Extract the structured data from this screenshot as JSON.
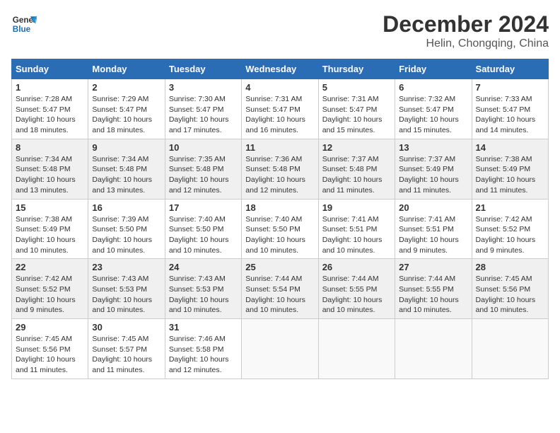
{
  "header": {
    "logo_line1": "General",
    "logo_line2": "Blue",
    "title": "December 2024",
    "subtitle": "Helin, Chongqing, China"
  },
  "calendar": {
    "weekdays": [
      "Sunday",
      "Monday",
      "Tuesday",
      "Wednesday",
      "Thursday",
      "Friday",
      "Saturday"
    ],
    "weeks": [
      [
        {
          "day": "",
          "info": ""
        },
        {
          "day": "",
          "info": ""
        },
        {
          "day": "",
          "info": ""
        },
        {
          "day": "",
          "info": ""
        },
        {
          "day": "5",
          "info": "Sunrise: 7:31 AM\nSunset: 5:47 PM\nDaylight: 10 hours\nand 15 minutes."
        },
        {
          "day": "6",
          "info": "Sunrise: 7:32 AM\nSunset: 5:47 PM\nDaylight: 10 hours\nand 15 minutes."
        },
        {
          "day": "7",
          "info": "Sunrise: 7:33 AM\nSunset: 5:47 PM\nDaylight: 10 hours\nand 14 minutes."
        }
      ],
      [
        {
          "day": "1",
          "info": "Sunrise: 7:28 AM\nSunset: 5:47 PM\nDaylight: 10 hours\nand 18 minutes."
        },
        {
          "day": "2",
          "info": "Sunrise: 7:29 AM\nSunset: 5:47 PM\nDaylight: 10 hours\nand 18 minutes."
        },
        {
          "day": "3",
          "info": "Sunrise: 7:30 AM\nSunset: 5:47 PM\nDaylight: 10 hours\nand 17 minutes."
        },
        {
          "day": "4",
          "info": "Sunrise: 7:31 AM\nSunset: 5:47 PM\nDaylight: 10 hours\nand 16 minutes."
        },
        {
          "day": "5",
          "info": "Sunrise: 7:31 AM\nSunset: 5:47 PM\nDaylight: 10 hours\nand 15 minutes."
        },
        {
          "day": "6",
          "info": "Sunrise: 7:32 AM\nSunset: 5:47 PM\nDaylight: 10 hours\nand 15 minutes."
        },
        {
          "day": "7",
          "info": "Sunrise: 7:33 AM\nSunset: 5:47 PM\nDaylight: 10 hours\nand 14 minutes."
        }
      ],
      [
        {
          "day": "8",
          "info": "Sunrise: 7:34 AM\nSunset: 5:48 PM\nDaylight: 10 hours\nand 13 minutes."
        },
        {
          "day": "9",
          "info": "Sunrise: 7:34 AM\nSunset: 5:48 PM\nDaylight: 10 hours\nand 13 minutes."
        },
        {
          "day": "10",
          "info": "Sunrise: 7:35 AM\nSunset: 5:48 PM\nDaylight: 10 hours\nand 12 minutes."
        },
        {
          "day": "11",
          "info": "Sunrise: 7:36 AM\nSunset: 5:48 PM\nDaylight: 10 hours\nand 12 minutes."
        },
        {
          "day": "12",
          "info": "Sunrise: 7:37 AM\nSunset: 5:48 PM\nDaylight: 10 hours\nand 11 minutes."
        },
        {
          "day": "13",
          "info": "Sunrise: 7:37 AM\nSunset: 5:49 PM\nDaylight: 10 hours\nand 11 minutes."
        },
        {
          "day": "14",
          "info": "Sunrise: 7:38 AM\nSunset: 5:49 PM\nDaylight: 10 hours\nand 11 minutes."
        }
      ],
      [
        {
          "day": "15",
          "info": "Sunrise: 7:38 AM\nSunset: 5:49 PM\nDaylight: 10 hours\nand 10 minutes."
        },
        {
          "day": "16",
          "info": "Sunrise: 7:39 AM\nSunset: 5:50 PM\nDaylight: 10 hours\nand 10 minutes."
        },
        {
          "day": "17",
          "info": "Sunrise: 7:40 AM\nSunset: 5:50 PM\nDaylight: 10 hours\nand 10 minutes."
        },
        {
          "day": "18",
          "info": "Sunrise: 7:40 AM\nSunset: 5:50 PM\nDaylight: 10 hours\nand 10 minutes."
        },
        {
          "day": "19",
          "info": "Sunrise: 7:41 AM\nSunset: 5:51 PM\nDaylight: 10 hours\nand 10 minutes."
        },
        {
          "day": "20",
          "info": "Sunrise: 7:41 AM\nSunset: 5:51 PM\nDaylight: 10 hours\nand 9 minutes."
        },
        {
          "day": "21",
          "info": "Sunrise: 7:42 AM\nSunset: 5:52 PM\nDaylight: 10 hours\nand 9 minutes."
        }
      ],
      [
        {
          "day": "22",
          "info": "Sunrise: 7:42 AM\nSunset: 5:52 PM\nDaylight: 10 hours\nand 9 minutes."
        },
        {
          "day": "23",
          "info": "Sunrise: 7:43 AM\nSunset: 5:53 PM\nDaylight: 10 hours\nand 10 minutes."
        },
        {
          "day": "24",
          "info": "Sunrise: 7:43 AM\nSunset: 5:53 PM\nDaylight: 10 hours\nand 10 minutes."
        },
        {
          "day": "25",
          "info": "Sunrise: 7:44 AM\nSunset: 5:54 PM\nDaylight: 10 hours\nand 10 minutes."
        },
        {
          "day": "26",
          "info": "Sunrise: 7:44 AM\nSunset: 5:55 PM\nDaylight: 10 hours\nand 10 minutes."
        },
        {
          "day": "27",
          "info": "Sunrise: 7:44 AM\nSunset: 5:55 PM\nDaylight: 10 hours\nand 10 minutes."
        },
        {
          "day": "28",
          "info": "Sunrise: 7:45 AM\nSunset: 5:56 PM\nDaylight: 10 hours\nand 10 minutes."
        }
      ],
      [
        {
          "day": "29",
          "info": "Sunrise: 7:45 AM\nSunset: 5:56 PM\nDaylight: 10 hours\nand 11 minutes."
        },
        {
          "day": "30",
          "info": "Sunrise: 7:45 AM\nSunset: 5:57 PM\nDaylight: 10 hours\nand 11 minutes."
        },
        {
          "day": "31",
          "info": "Sunrise: 7:46 AM\nSunset: 5:58 PM\nDaylight: 10 hours\nand 12 minutes."
        },
        {
          "day": "",
          "info": ""
        },
        {
          "day": "",
          "info": ""
        },
        {
          "day": "",
          "info": ""
        },
        {
          "day": "",
          "info": ""
        }
      ]
    ]
  }
}
